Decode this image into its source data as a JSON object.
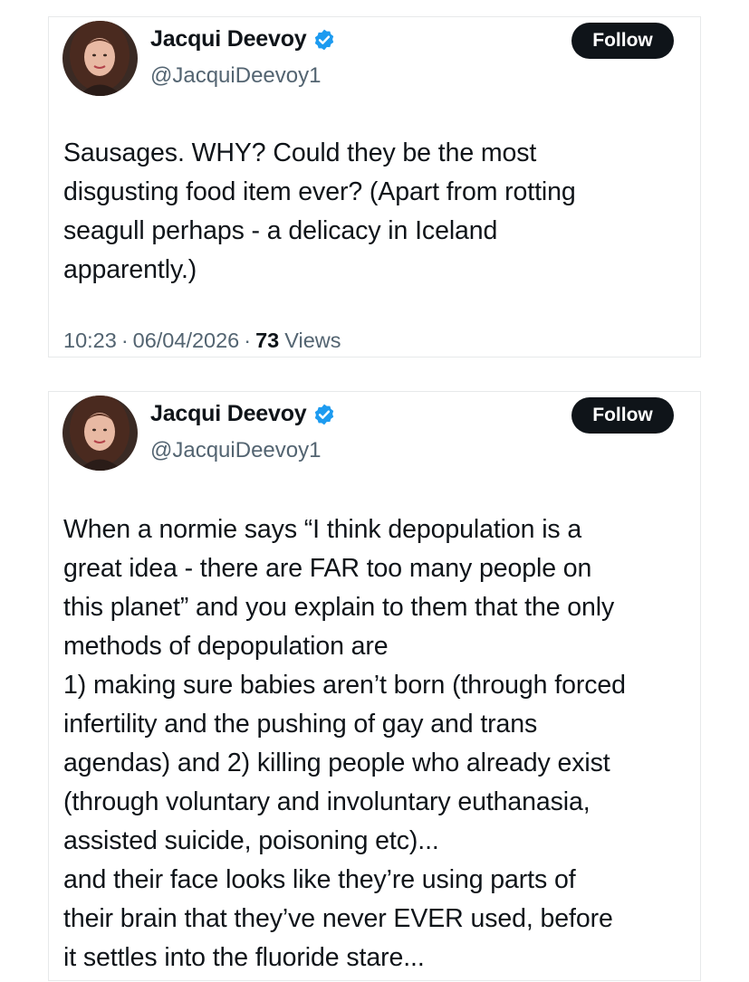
{
  "colors": {
    "text": "#0f1419",
    "secondary": "#536471",
    "verified": "#1d9bf0",
    "button_bg": "#0f1419",
    "button_text": "#ffffff",
    "border": "#e7e9ea"
  },
  "posts": [
    {
      "author": {
        "display_name": "Jacqui Deevoy",
        "handle": "@JacquiDeevoy1",
        "verified": true,
        "avatar_icon": "profile-photo"
      },
      "follow_label": "Follow",
      "text": "Sausages. WHY? Could they be the most\ndisgusting food item ever? (Apart from rotting\nseagull perhaps - a delicacy in Iceland\napparently.)",
      "time": "10:23",
      "date": "06/04/2026",
      "separator": "·",
      "views_count": "73",
      "views_label": "Views"
    },
    {
      "author": {
        "display_name": "Jacqui Deevoy",
        "handle": "@JacquiDeevoy1",
        "verified": true,
        "avatar_icon": "profile-photo"
      },
      "follow_label": "Follow",
      "text": "When a normie says “I think depopulation is a\ngreat idea - there are FAR too many people on\nthis planet” and you explain to them that the only\nmethods of depopulation are\n1) making sure babies aren’t born (through forced\ninfertility and the pushing of gay and trans\nagendas) and 2) killing people who already exist\n(through voluntary and involuntary euthanasia,\nassisted suicide, poisoning etc)...\nand their face looks like they’re using parts of\ntheir brain that they’ve never EVER used, before\nit settles into the fluoride stare..."
    }
  ]
}
